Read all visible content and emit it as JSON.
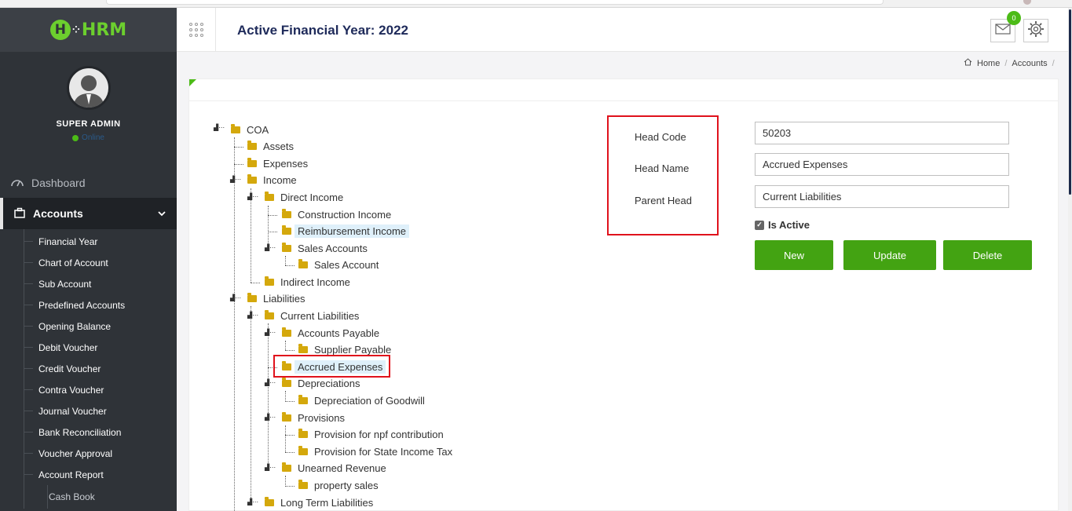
{
  "app": {
    "logo_text": "HRM",
    "page_title": "Active Financial Year: 2022",
    "mail_count": "0"
  },
  "user": {
    "name": "SUPER ADMIN",
    "status": "Online"
  },
  "sidebar": {
    "items": [
      {
        "label": "Dashboard",
        "icon": "dashboard-icon"
      },
      {
        "label": "Accounts",
        "icon": "briefcase-icon"
      }
    ],
    "accounts_sub": [
      "Financial Year",
      "Chart of Account",
      "Sub Account",
      "Predefined Accounts",
      "Opening Balance",
      "Debit Voucher",
      "Credit Voucher",
      "Contra Voucher",
      "Journal Voucher",
      "Bank Reconciliation",
      "Voucher Approval",
      "Account Report"
    ],
    "report_sub": [
      "Cash Book"
    ]
  },
  "breadcrumb": {
    "home": "Home",
    "current": "Accounts"
  },
  "tree": {
    "nodes": [
      "COA",
      "Assets",
      "Expenses",
      "Income",
      "Direct Income",
      "Construction Income",
      "Reimbursement Income",
      "Sales Accounts",
      "Sales Account",
      "Indirect Income",
      "Liabilities",
      "Current Liabilities",
      "Accounts Payable",
      "Supplier Payable",
      "Accrued Expenses",
      "Depreciations",
      "Depreciation of Goodwill",
      "Provisions",
      "Provision for npf contribution",
      "Provision for State Income Tax",
      "Unearned Revenue",
      "property sales",
      "Long Term Liabilities"
    ]
  },
  "form": {
    "head_code_label": "Head Code",
    "head_name_label": "Head Name",
    "parent_head_label": "Parent Head",
    "head_code_value": "50203",
    "head_name_value": "Accrued Expenses",
    "parent_head_value": "Current Liabilities",
    "is_active_label": "Is Active",
    "is_active": true,
    "new_label": "New",
    "update_label": "Update",
    "delete_label": "Delete"
  },
  "colors": {
    "sidebar": "#2f3338",
    "accent_green": "#43a312",
    "title_navy": "#1e2a5a",
    "highlight": "#e0121c"
  }
}
